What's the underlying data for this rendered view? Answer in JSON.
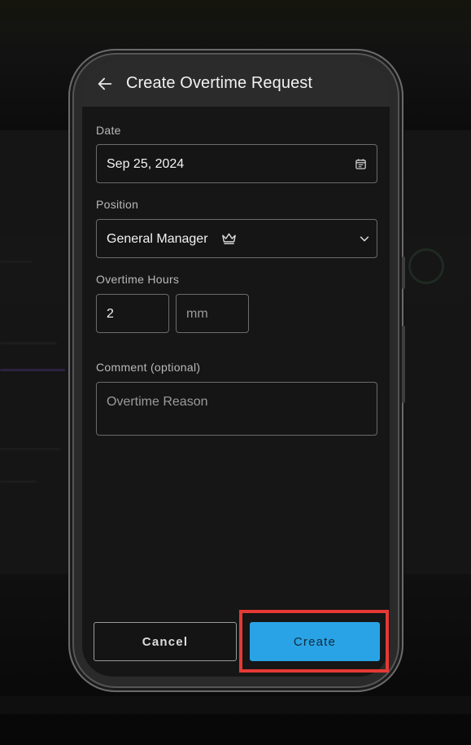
{
  "header": {
    "title": "Create Overtime Request"
  },
  "form": {
    "date": {
      "label": "Date",
      "value": "Sep 25, 2024"
    },
    "position": {
      "label": "Position",
      "value": "General Manager"
    },
    "overtime_hours": {
      "label": "Overtime Hours",
      "hours_value": "2",
      "minutes_placeholder": "mm"
    },
    "comment": {
      "label": "Comment (optional)",
      "placeholder": "Overtime Reason"
    }
  },
  "actions": {
    "cancel_label": "Cancel",
    "create_label": "Create"
  },
  "icons": {
    "back": "arrow-left-icon",
    "calendar": "calendar-icon",
    "crown": "crown-icon",
    "dropdown": "chevron-down-icon"
  },
  "colors": {
    "primary": "#2aa3e6",
    "highlight": "#e53935",
    "surface": "#161616",
    "appbar": "#2b2b2b"
  }
}
